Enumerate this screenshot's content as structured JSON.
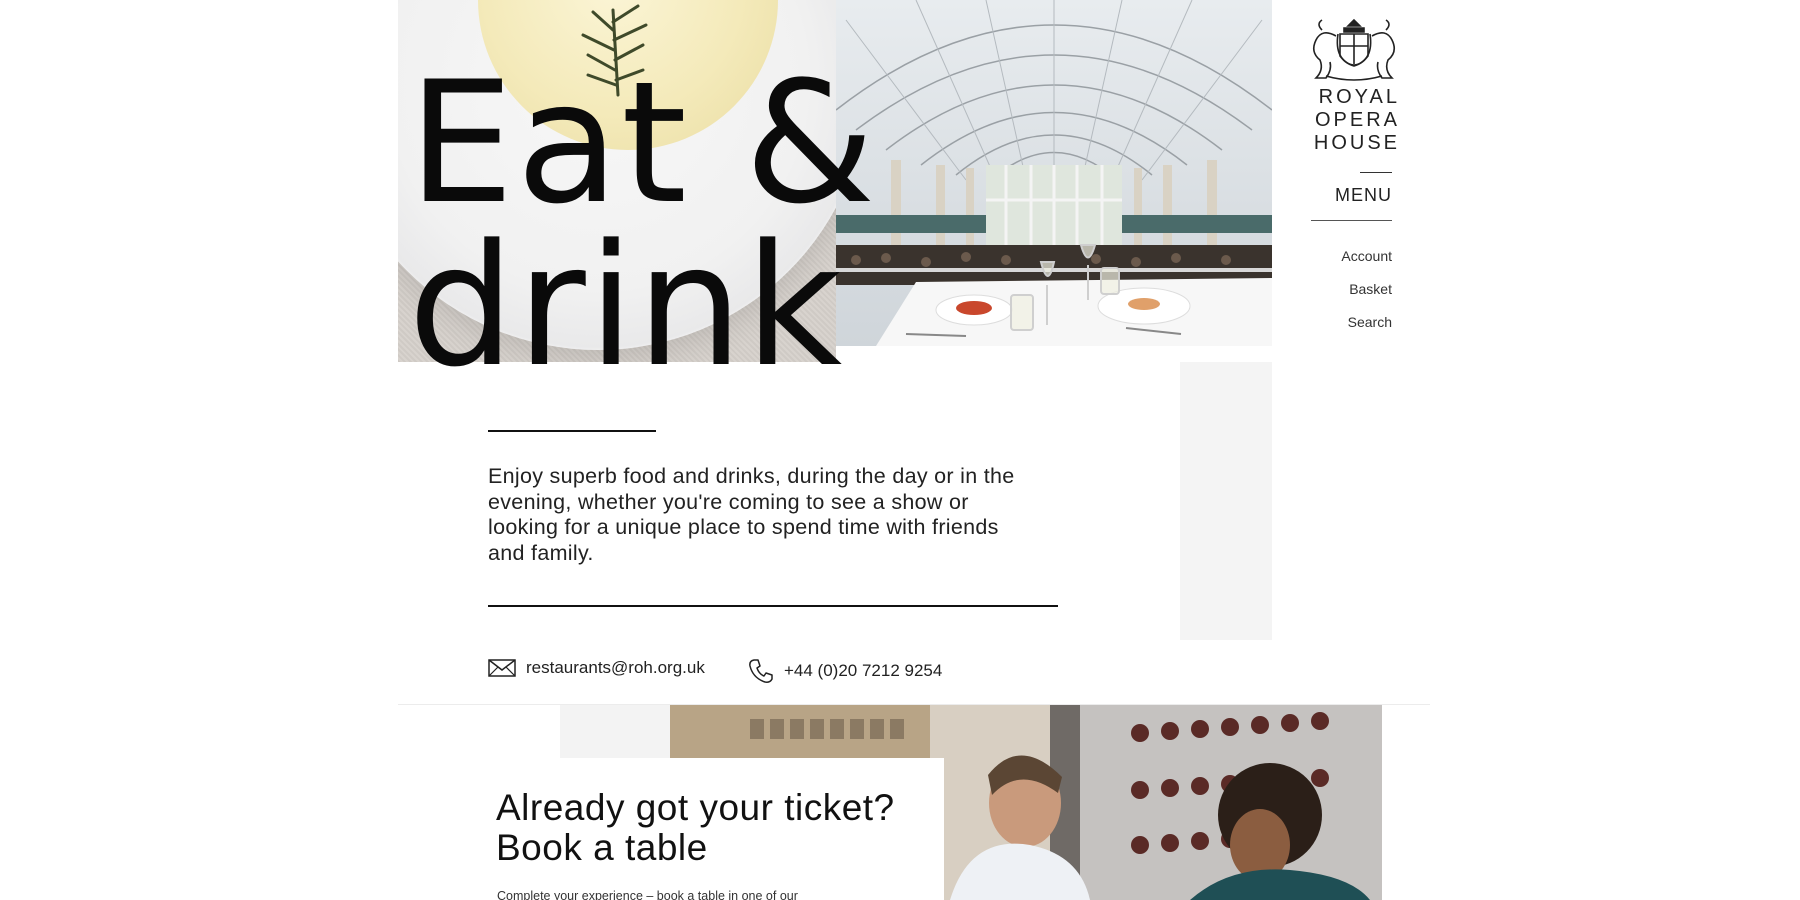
{
  "brand": {
    "name": "ROYAL\nOPERA\nHOUSE"
  },
  "nav": {
    "menu_label": "MENU",
    "links": [
      "Account",
      "Basket",
      "Search"
    ]
  },
  "hero": {
    "headline": "Eat &\ndrink"
  },
  "intro": {
    "text": "Enjoy superb food and drinks, during the day or in the evening, whether you're coming to see a show or looking for a unique place to spend time with friends and family."
  },
  "contact": {
    "email": "restaurants@roh.org.uk",
    "phone": "+44 (0)20 7212 9254"
  },
  "booking": {
    "title": "Already got your ticket? Book a table",
    "text": "Complete your experience – book a table in one of our"
  },
  "icons": {
    "email": "envelope-icon",
    "phone": "phone-icon",
    "crest": "royal-crest-icon"
  },
  "colors": {
    "text": "#111111",
    "panel_grey": "#f4f4f4",
    "background": "#ffffff"
  }
}
